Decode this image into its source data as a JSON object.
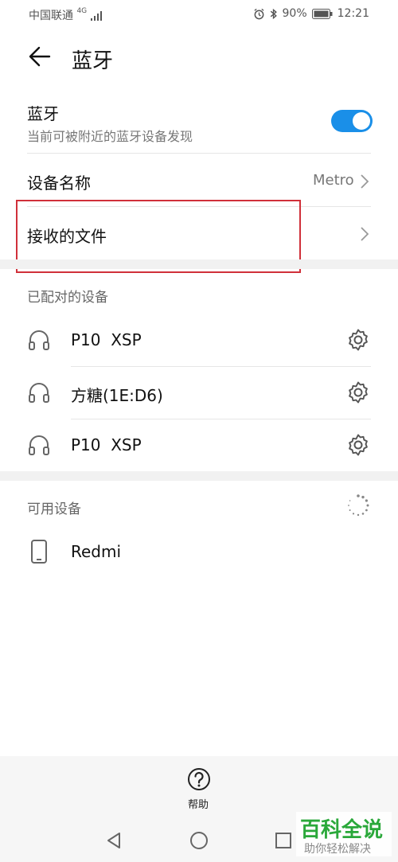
{
  "status_bar": {
    "carrier": "中国联通",
    "signal_tag": "4G",
    "battery": "90%",
    "time": "12:21"
  },
  "header": {
    "title": "蓝牙"
  },
  "bluetooth_toggle": {
    "title": "蓝牙",
    "subtitle": "当前可被附近的蓝牙设备发现",
    "enabled": true,
    "accent_color": "#1a8fe8"
  },
  "device_name": {
    "label": "设备名称",
    "value": "Metro"
  },
  "received_files": {
    "label": "接收的文件"
  },
  "paired": {
    "heading": "已配对的设备",
    "devices": [
      {
        "name": "P10  XSP",
        "icon": "headphones-icon"
      },
      {
        "name": "方糖(1E:D6)",
        "icon": "headphones-icon"
      },
      {
        "name": "P10  XSP",
        "icon": "headphones-icon"
      }
    ]
  },
  "available": {
    "heading": "可用设备",
    "devices": [
      {
        "name": "Redmi",
        "icon": "phone-icon"
      }
    ]
  },
  "help": {
    "label": "帮助"
  },
  "watermark": {
    "title": "百科全说",
    "subtitle": "助你轻松解决"
  }
}
